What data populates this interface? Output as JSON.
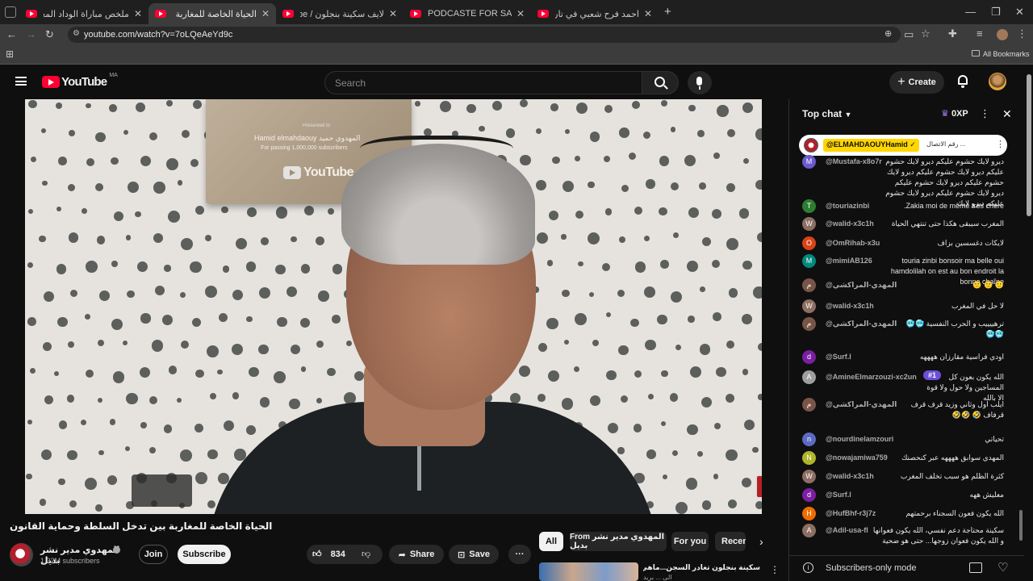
{
  "browser": {
    "tabs": [
      {
        "title": "ملخص مباراة الوداد المغربي و أو"
      },
      {
        "title": "الحياة الخاصة للمغاربة بين تدخل"
      },
      {
        "title": "لايف سكينة بنجلون / YouTube -"
      },
      {
        "title": "PODCASTE FOR SALE - Bassou"
      },
      {
        "title": "احمد فرح شعبي في تاريخ السينا"
      }
    ],
    "new_tab": "+",
    "url": "youtube.com/watch?v=7oLQeAeYd9c",
    "all_bookmarks": "All Bookmarks"
  },
  "youtube": {
    "logo_text": "YouTube",
    "region": "MA",
    "search_placeholder": "Search",
    "create_label": "Create"
  },
  "video": {
    "plaque_line1": "Presented to",
    "plaque_line2": "Hamid elmahdaouy المهدوي حميد",
    "plaque_line3": "For passing 1,000,000 subscribers",
    "plaque_logo": "YouTube",
    "title": "الحياة الخاصة للمغاربة بين تدخل السلطة وحماية القانون",
    "channel": "المهدوي مدير نشر بديل",
    "subscribers": "1.32M subscribers",
    "join": "Join",
    "subscribe": "Subscribe",
    "likes": "834",
    "share": "Share",
    "save": "Save"
  },
  "filters": {
    "all": "All",
    "from": "From المهدوي مدير نشر بديل",
    "for_you": "For you",
    "recent": "Recen"
  },
  "recommended": {
    "title": "سكينة بنجلون تغادر السجن...ماهي الدروس",
    "sub": "الى ... بريد"
  },
  "chat": {
    "header": "Top chat",
    "xp": "0XP",
    "pinned": {
      "name": "@ELMAHDAOUYHamid",
      "text": "... رقم الاتصال"
    },
    "messages": [
      {
        "name": "@Mustafa-x8o7r",
        "text": "ديرو لايك حشوم عليكم ديرو لايك حشوم عليكم ديرو لايك حشوم عليكم ديرو لايك حشوم عليكم ديرو لايك حشوم عليكم ديرو لايك حشوم عليكم ديرو لايك حشوم عليكم ديرو لايك",
        "color": "#6a5acd",
        "initial": "M"
      },
      {
        "name": "@touriazinbi",
        "text": "Zakia moi de même très chère.",
        "color": "#2e7d32",
        "initial": "T"
      },
      {
        "name": "@walid-x3c1h",
        "text": "المغرب سيبقى هكذا حتى تنتهي الحياة",
        "color": "#8d6e63",
        "initial": "W"
      },
      {
        "name": "@OmRihab-x3u",
        "text": "لايكات دغسسين بزاف",
        "color": "#d84315",
        "initial": "O"
      },
      {
        "name": "@mimiAB126",
        "text": "touria zinbi bonsoir ma belle oui hamdolilah on est au bon endroit la bonne chaîne",
        "color": "#00897b",
        "initial": "M"
      },
      {
        "name": "@المهدي-المراكشي",
        "text": "🙂 🙂 🙂",
        "color": "#795548",
        "initial": "م"
      },
      {
        "name": "@walid-x3c1h",
        "text": "لا حل في المغرب",
        "color": "#8d6e63",
        "initial": "W"
      },
      {
        "name": "@المهدي-المراكشي",
        "text": "ترهييييب و الحرب النفسية 🥶🥶🥶🥶",
        "color": "#795548",
        "initial": "م"
      },
      {
        "name": "@Surf.l",
        "text": "اودي فراسية مقارزان ههههه",
        "color": "#7b1fa2",
        "initial": "d"
      },
      {
        "name": "@AmineElmarzouzi-xc2un",
        "text": "الله يكون بعون كل المساجين ولا حول ولا قوة الا بالله",
        "color": "#9e9e9e",
        "initial": "A"
      },
      {
        "name": "@المهدي-المراكشي",
        "text": "ايلب اول وثاني وزيد قرف قرف قرفاف 🤣 🤣🤣",
        "color": "#795548",
        "initial": "م"
      },
      {
        "name": "@nourdinelamzouri",
        "text": "تحياتي",
        "color": "#5c6bc0",
        "initial": "n"
      },
      {
        "name": "@nowajamiwa759",
        "text": "المهدي سوابق ههههه عبر كنحصنك",
        "color": "#afb42b",
        "initial": "N"
      },
      {
        "name": "@walid-x3c1h",
        "text": "كثرة الظلم هو سبب تخلف المغرب",
        "color": "#8d6e63",
        "initial": "W"
      },
      {
        "name": "@Surf.l",
        "text": "معليش ههه",
        "color": "#7b1fa2",
        "initial": "d"
      },
      {
        "name": "@HufBhf-r3j7z",
        "text": "الله يكون فعون السجناء برحمتهم",
        "color": "#ef6c00",
        "initial": "H"
      },
      {
        "name": "@Adil-usa-fl",
        "text": "سكينة محتاجة دعم نفسي، الله يكون فعوانها و الله يكون فعوان زوجها... حتى هو ضحية",
        "color": "#8d6e63",
        "initial": "A"
      }
    ],
    "badge": "#1",
    "footer": "Subscribers-only mode"
  }
}
